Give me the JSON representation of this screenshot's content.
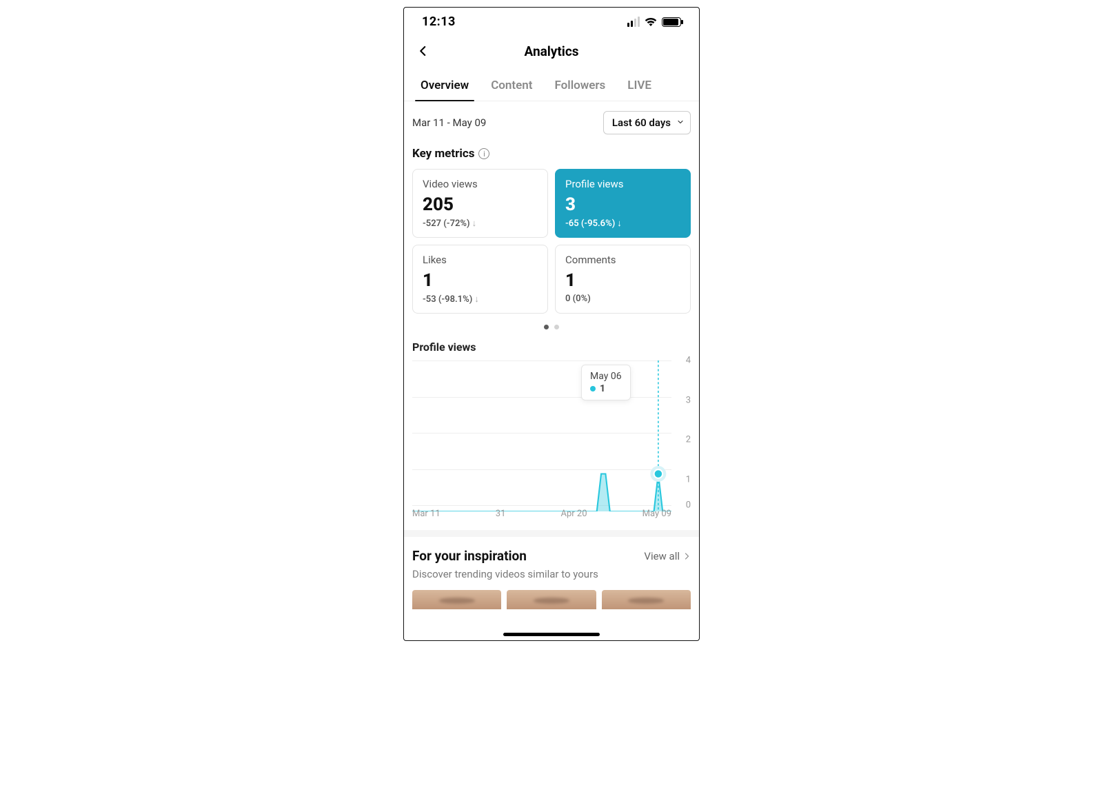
{
  "status": {
    "time": "12:13"
  },
  "header": {
    "title": "Analytics"
  },
  "tabs": [
    {
      "label": "Overview",
      "active": true
    },
    {
      "label": "Content",
      "active": false
    },
    {
      "label": "Followers",
      "active": false
    },
    {
      "label": "LIVE",
      "active": false
    }
  ],
  "date_range": "Mar 11 - May 09",
  "range_selector": {
    "label": "Last 60 days"
  },
  "key_metrics_title": "Key metrics",
  "metrics": [
    {
      "label": "Video views",
      "value": "205",
      "change": "-527 (-72%)",
      "direction": "down",
      "active": false
    },
    {
      "label": "Profile views",
      "value": "3",
      "change": "-65 (-95.6%)",
      "direction": "down",
      "active": true
    },
    {
      "label": "Likes",
      "value": "1",
      "change": "-53 (-98.1%)",
      "direction": "down",
      "active": false
    },
    {
      "label": "Comments",
      "value": "1",
      "change": "0 (0%)",
      "direction": "none",
      "active": false
    }
  ],
  "chart_title": "Profile views",
  "chart_data": {
    "type": "line",
    "title": "Profile views",
    "xlabel": "",
    "ylabel": "",
    "ylim": [
      0,
      4
    ],
    "y_ticks": [
      "0",
      "1",
      "2",
      "3",
      "4"
    ],
    "x_tick_labels": [
      "Mar 11",
      "31",
      "Apr 20",
      "May 09"
    ],
    "categories_days_index": [
      0,
      1,
      2,
      3,
      4,
      5,
      6,
      7,
      8,
      9,
      10,
      11,
      12,
      13,
      14,
      15,
      16,
      17,
      18,
      19,
      20,
      21,
      22,
      23,
      24,
      25,
      26,
      27,
      28,
      29,
      30,
      31,
      32,
      33,
      34,
      35,
      36,
      37,
      38,
      39,
      40,
      41,
      42,
      43,
      44,
      45,
      46,
      47,
      48,
      49,
      50,
      51,
      52,
      53,
      54,
      55,
      56,
      57,
      58,
      59
    ],
    "values": [
      0,
      0,
      0,
      0,
      0,
      0,
      0,
      0,
      0,
      0,
      0,
      0,
      0,
      0,
      0,
      0,
      0,
      0,
      0,
      0,
      0,
      0,
      0,
      0,
      0,
      0,
      0,
      0,
      0,
      0,
      0,
      0,
      0,
      0,
      0,
      0,
      0,
      0,
      0,
      0,
      0,
      0,
      0,
      1,
      1,
      0,
      0,
      0,
      0,
      0,
      0,
      0,
      0,
      0,
      0,
      0,
      1,
      0,
      0,
      0
    ],
    "selected_point": {
      "index": 56,
      "date_label": "May 06",
      "value": 1
    },
    "series_color": "#28c7dd"
  },
  "tooltip": {
    "date": "May 06",
    "value": "1"
  },
  "inspiration": {
    "title": "For your inspiration",
    "view_all": "View all",
    "subtitle": "Discover trending videos similar to yours"
  }
}
